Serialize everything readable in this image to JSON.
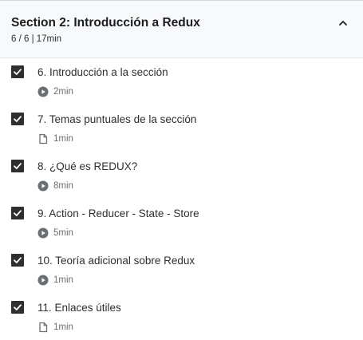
{
  "section": {
    "title": "Section 2: Introducción a Redux",
    "progress": "6 / 6 | 17min",
    "expanded": true
  },
  "lectures": [
    {
      "title": "6. Introducción a la sección",
      "type": "video",
      "duration": "2min",
      "completed": true
    },
    {
      "title": "7. Temas puntuales de la sección",
      "type": "article",
      "duration": "1min",
      "completed": true
    },
    {
      "title": "8. ¿Qué es REDUX?",
      "type": "video",
      "duration": "8min",
      "completed": true
    },
    {
      "title": "9. Action - Reducer - State - Store",
      "type": "video",
      "duration": "5min",
      "completed": true
    },
    {
      "title": "10. Teoría adicional sobre Redux",
      "type": "video",
      "duration": "1min",
      "completed": true
    },
    {
      "title": "11. Enlaces útiles",
      "type": "article",
      "duration": "1min",
      "completed": true
    }
  ],
  "colors": {
    "header_bg": "#f7f9fa",
    "checkbox": "#2d2f31",
    "muted_text": "#6a6f73"
  }
}
